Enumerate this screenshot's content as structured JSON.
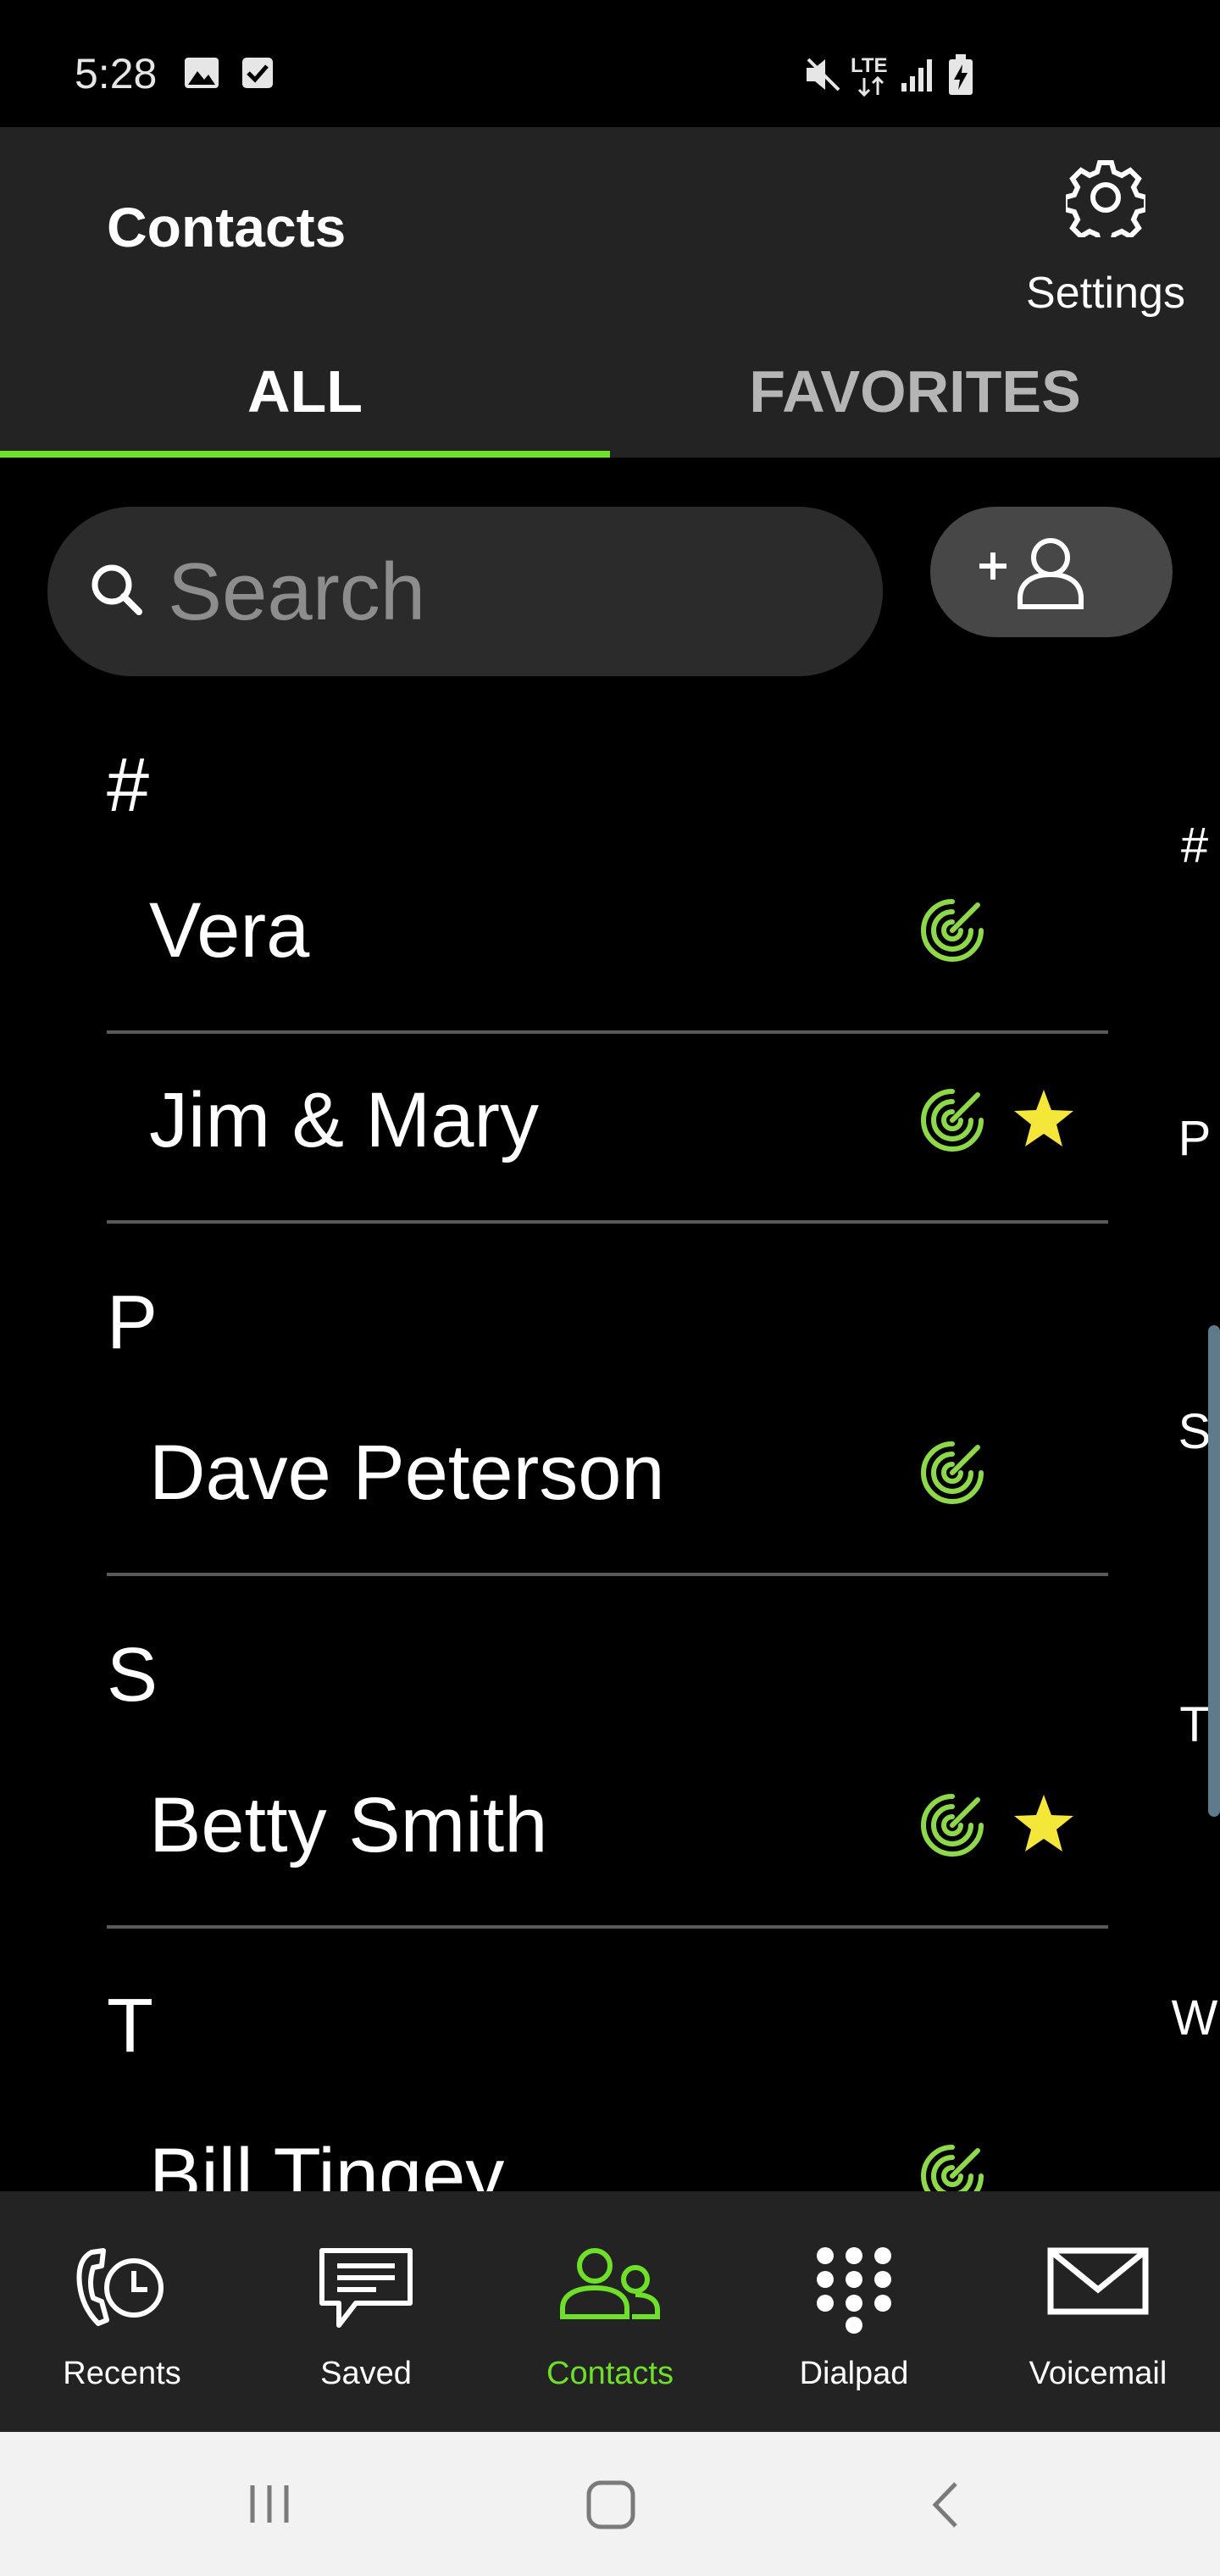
{
  "status_bar": {
    "time": "5:28",
    "network": "LTE"
  },
  "app_bar": {
    "title": "Contacts",
    "settings_label": "Settings"
  },
  "tabs": [
    {
      "label": "ALL",
      "active": true
    },
    {
      "label": "FAVORITES",
      "active": false
    }
  ],
  "search": {
    "placeholder": "Search",
    "value": ""
  },
  "add_contact_icon": "add-contact-icon",
  "contacts": {
    "sections": [
      {
        "header": "#",
        "items": [
          {
            "name": "Vera",
            "favorite": false
          },
          {
            "name": "Jim & Mary",
            "favorite": true
          }
        ]
      },
      {
        "header": "P",
        "items": [
          {
            "name": "Dave Peterson",
            "favorite": false
          }
        ]
      },
      {
        "header": "S",
        "items": [
          {
            "name": "Betty Smith",
            "favorite": true
          }
        ]
      },
      {
        "header": "T",
        "items": [
          {
            "name": "Bill Tingey",
            "favorite": false
          }
        ]
      }
    ]
  },
  "index_letters": [
    "#",
    "P",
    "S",
    "T",
    "W"
  ],
  "bottom_nav": [
    {
      "label": "Recents",
      "icon": "recents-icon",
      "active": false
    },
    {
      "label": "Saved",
      "icon": "saved-message-icon",
      "active": false
    },
    {
      "label": "Contacts",
      "icon": "contacts-icon",
      "active": true
    },
    {
      "label": "Dialpad",
      "icon": "dialpad-icon",
      "active": false
    },
    {
      "label": "Voicemail",
      "icon": "voicemail-icon",
      "active": false
    }
  ],
  "colors": {
    "accent": "#6ee02a",
    "background": "#000000",
    "bar": "#232323",
    "star": "#f5e63a",
    "radar": "#8ed94a"
  }
}
